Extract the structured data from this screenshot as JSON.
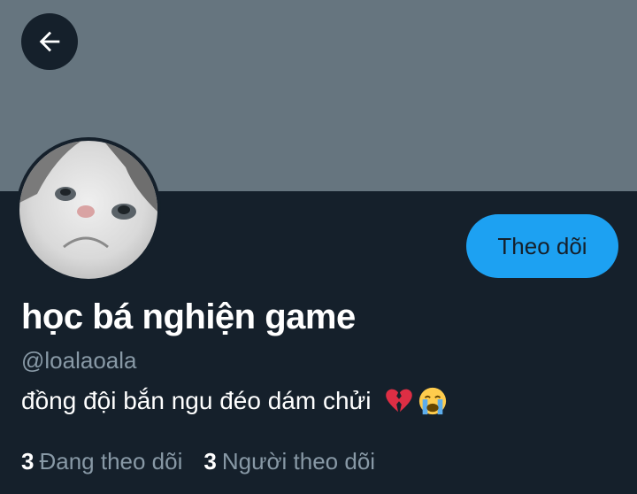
{
  "profile": {
    "display_name": "học bá nghiện game",
    "handle": "@loalaoala",
    "bio_text": "đồng đội bắn ngu đéo dám chửi",
    "bio_emojis": [
      "broken-heart-icon",
      "crying-face-icon"
    ]
  },
  "actions": {
    "follow_label": "Theo dõi",
    "back_icon": "arrow-left-icon"
  },
  "stats": {
    "following_count": "3",
    "following_label": "Đang theo dõi",
    "followers_count": "3",
    "followers_label": "Người theo dõi"
  },
  "colors": {
    "background": "#15202b",
    "banner": "#66757f",
    "accent": "#1da1f2",
    "secondary_text": "#8899a6"
  }
}
